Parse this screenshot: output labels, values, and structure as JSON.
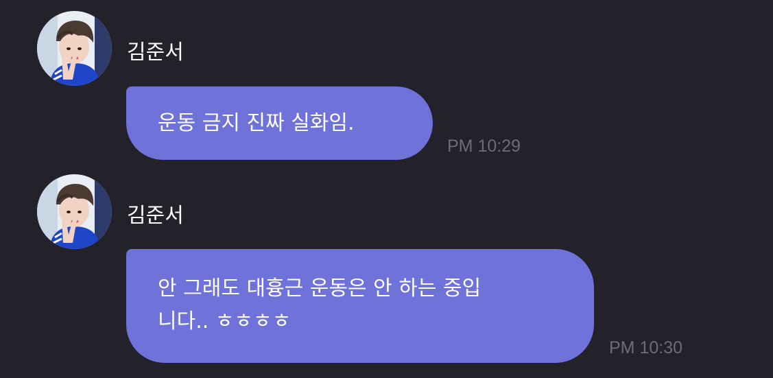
{
  "messages": [
    {
      "sender": "김준서",
      "text": "운동 금지 진짜 실화임.",
      "time": "PM 10:29"
    },
    {
      "sender": "김준서",
      "text": "안 그래도 대흉근 운동은 안 하는 중입\n니다.. ㅎㅎㅎㅎ",
      "time": "PM 10:30"
    }
  ],
  "colors": {
    "background": "#23222b",
    "bubble": "#6e72d9",
    "time": "#6e6d75",
    "text": "#ffffff"
  },
  "icons": {
    "avatar": "profile-photo-avatar"
  }
}
